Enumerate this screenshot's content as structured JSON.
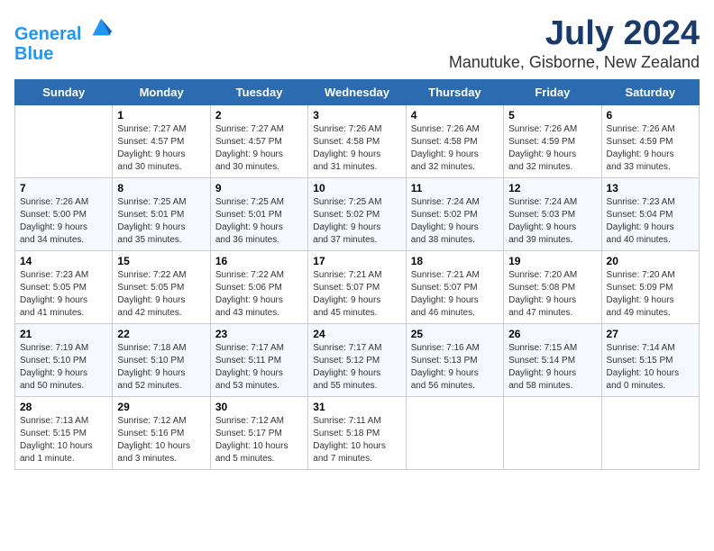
{
  "header": {
    "logo_line1": "General",
    "logo_line2": "Blue",
    "month_title": "July 2024",
    "location": "Manutuke, Gisborne, New Zealand"
  },
  "days_of_week": [
    "Sunday",
    "Monday",
    "Tuesday",
    "Wednesday",
    "Thursday",
    "Friday",
    "Saturday"
  ],
  "weeks": [
    [
      {
        "day": "",
        "info": ""
      },
      {
        "day": "1",
        "info": "Sunrise: 7:27 AM\nSunset: 4:57 PM\nDaylight: 9 hours\nand 30 minutes."
      },
      {
        "day": "2",
        "info": "Sunrise: 7:27 AM\nSunset: 4:57 PM\nDaylight: 9 hours\nand 30 minutes."
      },
      {
        "day": "3",
        "info": "Sunrise: 7:26 AM\nSunset: 4:58 PM\nDaylight: 9 hours\nand 31 minutes."
      },
      {
        "day": "4",
        "info": "Sunrise: 7:26 AM\nSunset: 4:58 PM\nDaylight: 9 hours\nand 32 minutes."
      },
      {
        "day": "5",
        "info": "Sunrise: 7:26 AM\nSunset: 4:59 PM\nDaylight: 9 hours\nand 32 minutes."
      },
      {
        "day": "6",
        "info": "Sunrise: 7:26 AM\nSunset: 4:59 PM\nDaylight: 9 hours\nand 33 minutes."
      }
    ],
    [
      {
        "day": "7",
        "info": "Sunrise: 7:26 AM\nSunset: 5:00 PM\nDaylight: 9 hours\nand 34 minutes."
      },
      {
        "day": "8",
        "info": "Sunrise: 7:25 AM\nSunset: 5:01 PM\nDaylight: 9 hours\nand 35 minutes."
      },
      {
        "day": "9",
        "info": "Sunrise: 7:25 AM\nSunset: 5:01 PM\nDaylight: 9 hours\nand 36 minutes."
      },
      {
        "day": "10",
        "info": "Sunrise: 7:25 AM\nSunset: 5:02 PM\nDaylight: 9 hours\nand 37 minutes."
      },
      {
        "day": "11",
        "info": "Sunrise: 7:24 AM\nSunset: 5:02 PM\nDaylight: 9 hours\nand 38 minutes."
      },
      {
        "day": "12",
        "info": "Sunrise: 7:24 AM\nSunset: 5:03 PM\nDaylight: 9 hours\nand 39 minutes."
      },
      {
        "day": "13",
        "info": "Sunrise: 7:23 AM\nSunset: 5:04 PM\nDaylight: 9 hours\nand 40 minutes."
      }
    ],
    [
      {
        "day": "14",
        "info": "Sunrise: 7:23 AM\nSunset: 5:05 PM\nDaylight: 9 hours\nand 41 minutes."
      },
      {
        "day": "15",
        "info": "Sunrise: 7:22 AM\nSunset: 5:05 PM\nDaylight: 9 hours\nand 42 minutes."
      },
      {
        "day": "16",
        "info": "Sunrise: 7:22 AM\nSunset: 5:06 PM\nDaylight: 9 hours\nand 43 minutes."
      },
      {
        "day": "17",
        "info": "Sunrise: 7:21 AM\nSunset: 5:07 PM\nDaylight: 9 hours\nand 45 minutes."
      },
      {
        "day": "18",
        "info": "Sunrise: 7:21 AM\nSunset: 5:07 PM\nDaylight: 9 hours\nand 46 minutes."
      },
      {
        "day": "19",
        "info": "Sunrise: 7:20 AM\nSunset: 5:08 PM\nDaylight: 9 hours\nand 47 minutes."
      },
      {
        "day": "20",
        "info": "Sunrise: 7:20 AM\nSunset: 5:09 PM\nDaylight: 9 hours\nand 49 minutes."
      }
    ],
    [
      {
        "day": "21",
        "info": "Sunrise: 7:19 AM\nSunset: 5:10 PM\nDaylight: 9 hours\nand 50 minutes."
      },
      {
        "day": "22",
        "info": "Sunrise: 7:18 AM\nSunset: 5:10 PM\nDaylight: 9 hours\nand 52 minutes."
      },
      {
        "day": "23",
        "info": "Sunrise: 7:17 AM\nSunset: 5:11 PM\nDaylight: 9 hours\nand 53 minutes."
      },
      {
        "day": "24",
        "info": "Sunrise: 7:17 AM\nSunset: 5:12 PM\nDaylight: 9 hours\nand 55 minutes."
      },
      {
        "day": "25",
        "info": "Sunrise: 7:16 AM\nSunset: 5:13 PM\nDaylight: 9 hours\nand 56 minutes."
      },
      {
        "day": "26",
        "info": "Sunrise: 7:15 AM\nSunset: 5:14 PM\nDaylight: 9 hours\nand 58 minutes."
      },
      {
        "day": "27",
        "info": "Sunrise: 7:14 AM\nSunset: 5:15 PM\nDaylight: 10 hours\nand 0 minutes."
      }
    ],
    [
      {
        "day": "28",
        "info": "Sunrise: 7:13 AM\nSunset: 5:15 PM\nDaylight: 10 hours\nand 1 minute."
      },
      {
        "day": "29",
        "info": "Sunrise: 7:12 AM\nSunset: 5:16 PM\nDaylight: 10 hours\nand 3 minutes."
      },
      {
        "day": "30",
        "info": "Sunrise: 7:12 AM\nSunset: 5:17 PM\nDaylight: 10 hours\nand 5 minutes."
      },
      {
        "day": "31",
        "info": "Sunrise: 7:11 AM\nSunset: 5:18 PM\nDaylight: 10 hours\nand 7 minutes."
      },
      {
        "day": "",
        "info": ""
      },
      {
        "day": "",
        "info": ""
      },
      {
        "day": "",
        "info": ""
      }
    ]
  ]
}
